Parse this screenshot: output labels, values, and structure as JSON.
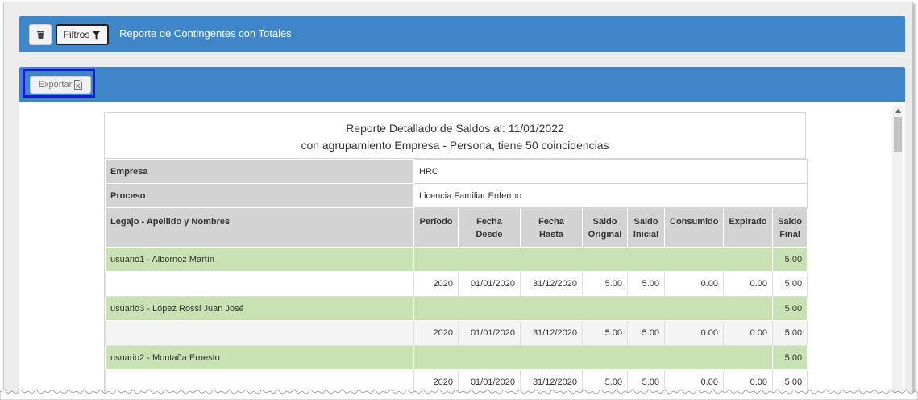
{
  "toolbar": {
    "trash_icon": "trash-icon",
    "filter_label": "Filtros",
    "filter_icon": "filter-icon",
    "title": "Reporte de Contingentes con Totales"
  },
  "export": {
    "label": "Exportar",
    "icon": "excel-file-icon"
  },
  "report": {
    "title_line1": "Reporte Detallado de Saldos al: 11/01/2022",
    "title_line2": "con agrupamiento Empresa - Persona, tiene 50 coincidencias",
    "empresa_label": "Empresa",
    "empresa_value": "HRC",
    "proceso_label": "Proceso",
    "proceso_value": "Licencia Familiar Enfermo",
    "columns": {
      "legajo": "Legajo - Apellido y Nombres",
      "periodo": "Período",
      "fecha_desde_1": "Fecha",
      "fecha_desde_2": "Desde",
      "fecha_hasta_1": "Fecha",
      "fecha_hasta_2": "Hasta",
      "saldo_original_1": "Saldo",
      "saldo_original_2": "Original",
      "saldo_inicial_1": "Saldo",
      "saldo_inicial_2": "Inicial",
      "consumido": "Consumido",
      "expirado": "Expirado",
      "saldo_final_1": "Saldo",
      "saldo_final_2": "Final"
    },
    "groups": [
      {
        "name": "usuario1 - Albornoz Martín",
        "total": "5.00",
        "detail": {
          "periodo": "2020",
          "desde": "01/01/2020",
          "hasta": "31/12/2020",
          "original": "5.00",
          "inicial": "5.00",
          "consumido": "0.00",
          "expirado": "0.00",
          "final": "5.00"
        }
      },
      {
        "name": "usuario3 - López Rossi Juan José",
        "total": "5.00",
        "detail": {
          "periodo": "2020",
          "desde": "01/01/2020",
          "hasta": "31/12/2020",
          "original": "5.00",
          "inicial": "5.00",
          "consumido": "0.00",
          "expirado": "0.00",
          "final": "5.00"
        }
      },
      {
        "name": "usuario2 - Montaña Ernesto",
        "total": "5.00",
        "detail": {
          "periodo": "2020",
          "desde": "01/01/2020",
          "hasta": "31/12/2020",
          "original": "5.00",
          "inicial": "5.00",
          "consumido": "0.00",
          "expirado": "0.00",
          "final": "5.00"
        }
      }
    ]
  },
  "colors": {
    "header_bar": "#3e86c8",
    "group_row": "#c9e2b3",
    "label_cell": "#d3d3d3",
    "highlight_border": "#1a1ad6"
  }
}
